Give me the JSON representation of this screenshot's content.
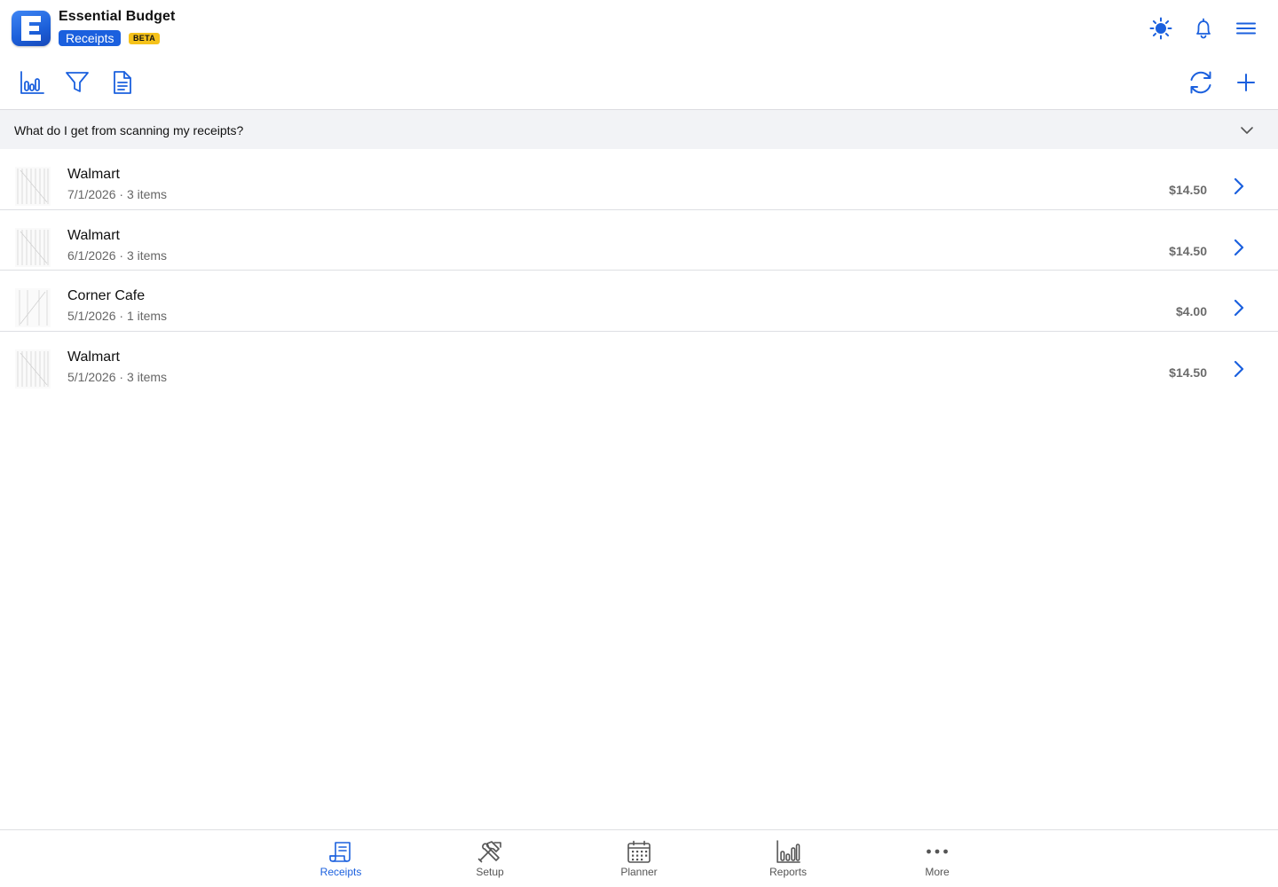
{
  "app": {
    "title": "Essential Budget",
    "section_badge": "Receipts",
    "beta_badge": "BETA",
    "logo_letter": "E"
  },
  "header_icons": [
    "theme-sun-icon",
    "bell-icon",
    "hamburger-menu-icon"
  ],
  "toolbar": {
    "left_icons": [
      "bar-chart-icon",
      "filter-icon",
      "document-icon"
    ],
    "right_icons": [
      "refresh-icon",
      "plus-icon"
    ]
  },
  "faq": {
    "question": "What do I get from scanning my receipts?",
    "icon": "chevron-down-icon"
  },
  "receipts": [
    {
      "merchant": "Walmart",
      "meta": "7/1/2026 · 3 items",
      "amount": "$14.50"
    },
    {
      "merchant": "Walmart",
      "meta": "6/1/2026 · 3 items",
      "amount": "$14.50"
    },
    {
      "merchant": "Corner Cafe",
      "meta": "5/1/2026 · 1 items",
      "amount": "$4.00"
    },
    {
      "merchant": "Walmart",
      "meta": "5/1/2026 · 3 items",
      "amount": "$14.50"
    }
  ],
  "tabs": [
    {
      "label": "Receipts",
      "icon": "receipt-icon",
      "active": true
    },
    {
      "label": "Setup",
      "icon": "tools-icon",
      "active": false
    },
    {
      "label": "Planner",
      "icon": "calendar-icon",
      "active": false
    },
    {
      "label": "Reports",
      "icon": "bar-chart-icon",
      "active": false
    },
    {
      "label": "More",
      "icon": "more-dots-icon",
      "active": false
    }
  ],
  "colors": {
    "accent": "#1b60de",
    "beta": "#f5c21a",
    "faq_bg": "#f2f3f6",
    "amount": "#6b6b6b",
    "tab_inactive": "#555555"
  }
}
